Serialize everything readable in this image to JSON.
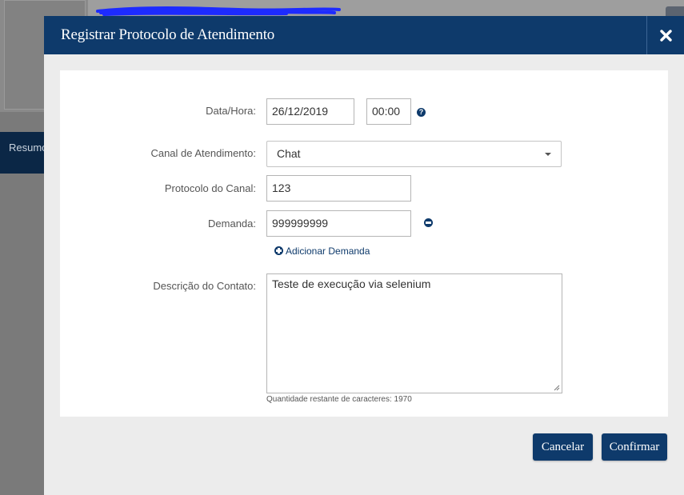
{
  "background": {
    "side_label": "Resumo"
  },
  "modal": {
    "title": "Registrar Protocolo de Atendimento",
    "close_icon": "close-x-icon"
  },
  "form": {
    "date_label": "Data/Hora:",
    "date_value": "26/12/2019",
    "time_value": "00:00",
    "help_icon": "question-circle-icon",
    "channel_label": "Canal de Atendimento:",
    "channel_value": "Chat",
    "protocol_label": "Protocolo do Canal:",
    "protocol_value": "123",
    "demand_label": "Demanda:",
    "demand_value": "999999999",
    "remove_icon": "minus-circle-icon",
    "add_demand_label": "Adicionar Demanda",
    "description_label": "Descrição do Contato:",
    "description_value": "Teste de execução via selenium",
    "chars_remaining": "Quantidade restante de caracteres: 1970"
  },
  "footer": {
    "cancel_label": "Cancelar",
    "confirm_label": "Confirmar"
  },
  "colors": {
    "primary": "#0e3a6b",
    "overlay": "#7a7a7a",
    "body_bg": "#ececec"
  }
}
